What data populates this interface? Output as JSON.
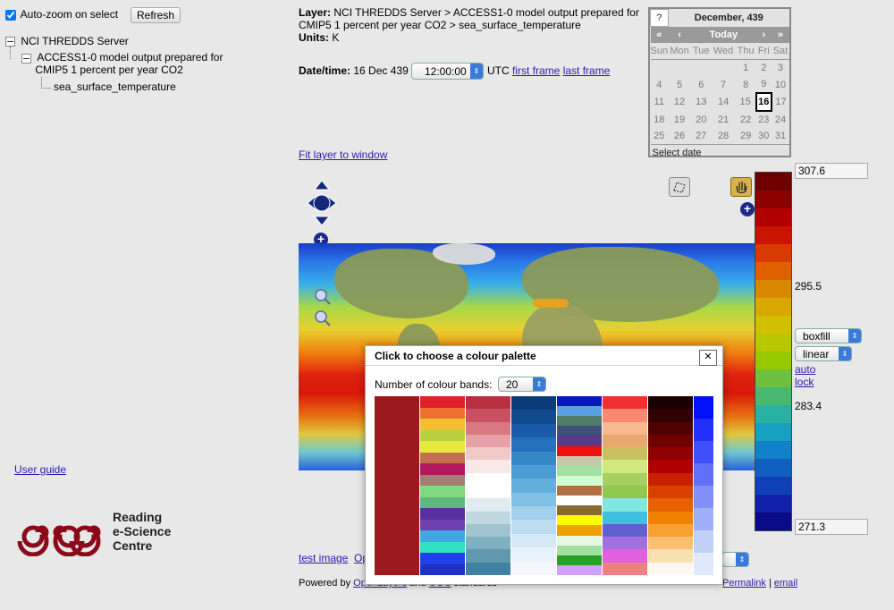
{
  "left": {
    "autozoom_label": "Auto-zoom on select",
    "refresh_label": "Refresh",
    "tree": {
      "root": "NCI THREDDS Server",
      "child_line1": "ACCESS1-0 model output prepared for",
      "child_line2": "CMIP5 1 percent per year CO2",
      "leaf": "sea_surface_temperature"
    },
    "user_guide": "User guide",
    "logo": {
      "line1": "Reading",
      "line2": "e-Science",
      "line3": "Centre"
    }
  },
  "info": {
    "layer_label": "Layer:",
    "layer_line1": "NCI THREDDS Server > ACCESS1-0 model output prepared for",
    "layer_line2": "CMIP5 1 percent per year CO2 > sea_surface_temperature",
    "units_label": "Units:",
    "units_value": "K",
    "datetime_label": "Date/time:",
    "date_value": "16 Dec 439",
    "time_value": "12:00:00",
    "tz": "UTC",
    "first_frame": "first frame",
    "last_frame": "last frame",
    "fit_layer": "Fit layer to window"
  },
  "calendar": {
    "help": "?",
    "month": "December, 439",
    "nav": [
      "«",
      "‹",
      "Today",
      "›",
      "»"
    ],
    "weekdays": [
      "Sun",
      "Mon",
      "Tue",
      "Wed",
      "Thu",
      "Fri",
      "Sat"
    ],
    "weeks": [
      [
        "",
        "",
        "",
        "",
        "1",
        "2",
        "3"
      ],
      [
        "4",
        "5",
        "6",
        "7",
        "8",
        "9",
        "10"
      ],
      [
        "11",
        "12",
        "13",
        "14",
        "15",
        "16",
        "17"
      ],
      [
        "18",
        "19",
        "20",
        "21",
        "22",
        "23",
        "24"
      ],
      [
        "25",
        "26",
        "27",
        "28",
        "29",
        "30",
        "31"
      ]
    ],
    "selected": "16",
    "footer": "Select date"
  },
  "colorbar": {
    "max": "307.6",
    "tick_high": "295.5",
    "tick_mid": "283.4",
    "min": "271.3",
    "style": "boxfill",
    "scale": "linear",
    "auto": "auto",
    "lock": "lock",
    "colors": [
      "#6e0000",
      "#8c0000",
      "#b00000",
      "#c81400",
      "#d83a00",
      "#e06000",
      "#d88800",
      "#d8a800",
      "#d0c000",
      "#b8c800",
      "#98c800",
      "#70c040",
      "#48b870",
      "#28b0a0",
      "#18a0c0",
      "#1080c8",
      "#1060c0",
      "#1040b8",
      "#1020a8",
      "#080c88"
    ]
  },
  "bottom": {
    "test_image": "test image",
    "op_link": "Op",
    "powered_by": "Powered by",
    "openlayers": "OpenLayers",
    "and": "and",
    "ogc": "OGC",
    "standards": "standards",
    "permalink": "Permalink",
    "sep": "|",
    "email": "email",
    "opacity_suffix": "%"
  },
  "dialog": {
    "title": "Click to choose a colour palette",
    "close": "✕",
    "bands_label": "Number of colour bands:",
    "bands_value": "20",
    "palettes": [
      [
        "#9c1a1e"
      ],
      [
        "#e0202a",
        "#f07030",
        "#f0c030",
        "#b8d040",
        "#e8e840",
        "#c07050",
        "#b01860",
        "#a08070",
        "#80d880",
        "#60b880",
        "#5830a0",
        "#7040b0",
        "#40a8e0",
        "#30e0c0",
        "#2040e8",
        "#2030c0"
      ],
      [
        "#b83040",
        "#c85060",
        "#d87880",
        "#e8a0a8",
        "#f0c8c8",
        "#f8e8e8",
        "#ffffff",
        "#ffffff",
        "#e0ecf0",
        "#c0d8e0",
        "#a0c4d0",
        "#80b0c0",
        "#6098b0",
        "#4080a0"
      ],
      [
        "#0a3c7a",
        "#124a90",
        "#1a5aa8",
        "#2470bc",
        "#3488c8",
        "#4c9cd4",
        "#64b0dc",
        "#80c0e4",
        "#a0d0ec",
        "#bcdcf0",
        "#d4e8f6",
        "#e8f2fa",
        "#f4f8fc"
      ],
      [
        "#0818c0",
        "#5aa0e0",
        "#507a6a",
        "#405078",
        "#5a3a8a",
        "#f01010",
        "#c8c8a8",
        "#a0e0a0",
        "#d0ffd0",
        "#b07040",
        "#ffffff",
        "#8a6a30",
        "#ffff00",
        "#f0a000",
        "#e8f8e0",
        "#a0e0a0",
        "#28a028",
        "#d0a0ff"
      ],
      [
        "#f03030",
        "#f88870",
        "#f8b890",
        "#e8a870",
        "#c8c060",
        "#d0e880",
        "#a8d060",
        "#90c850",
        "#80e8e0",
        "#40c0e0",
        "#6060d0",
        "#a070e0",
        "#e060e0",
        "#f08080"
      ],
      [
        "#1a0000",
        "#300000",
        "#500000",
        "#700000",
        "#900000",
        "#b00000",
        "#c82000",
        "#d84000",
        "#e86000",
        "#f08000",
        "#f8a030",
        "#f8c070",
        "#f8e0b0",
        "#fff8f0"
      ],
      [
        "#0010f8",
        "#2030f8",
        "#4050f8",
        "#6070f8",
        "#8090f8",
        "#a0b0f8",
        "#c0d0f8",
        "#e0e8fc"
      ]
    ]
  }
}
